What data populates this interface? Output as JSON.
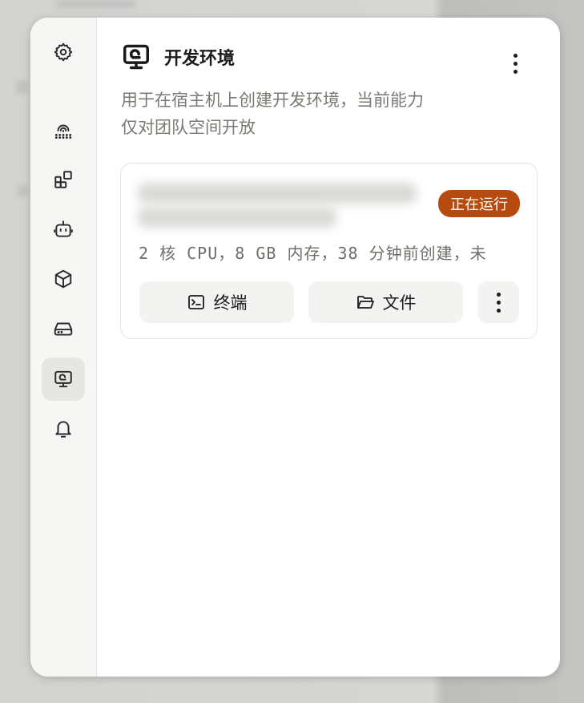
{
  "header": {
    "title": "开发环境",
    "description_lines": [
      "用于在宿主机上创建开发环境，当前能力",
      "仅对团队空间开放"
    ]
  },
  "rail": {
    "items": [
      {
        "icon": "gear-icon",
        "active": false
      },
      {
        "icon": "fingerprint-password-icon",
        "active": false
      },
      {
        "icon": "apps-grid-icon",
        "active": false
      },
      {
        "icon": "robot-icon",
        "active": false
      },
      {
        "icon": "cube-icon",
        "active": false
      },
      {
        "icon": "hard-drive-icon",
        "active": false
      },
      {
        "icon": "monitor-icon",
        "active": true
      },
      {
        "icon": "bell-icon",
        "active": false
      }
    ]
  },
  "environment_card": {
    "status": "正在运行",
    "status_color": "#b74a0e",
    "specs": "2 核 CPU，8 GB 内存，38 分钟前创建，未",
    "actions": {
      "terminal_label": "终端",
      "files_label": "文件"
    }
  }
}
